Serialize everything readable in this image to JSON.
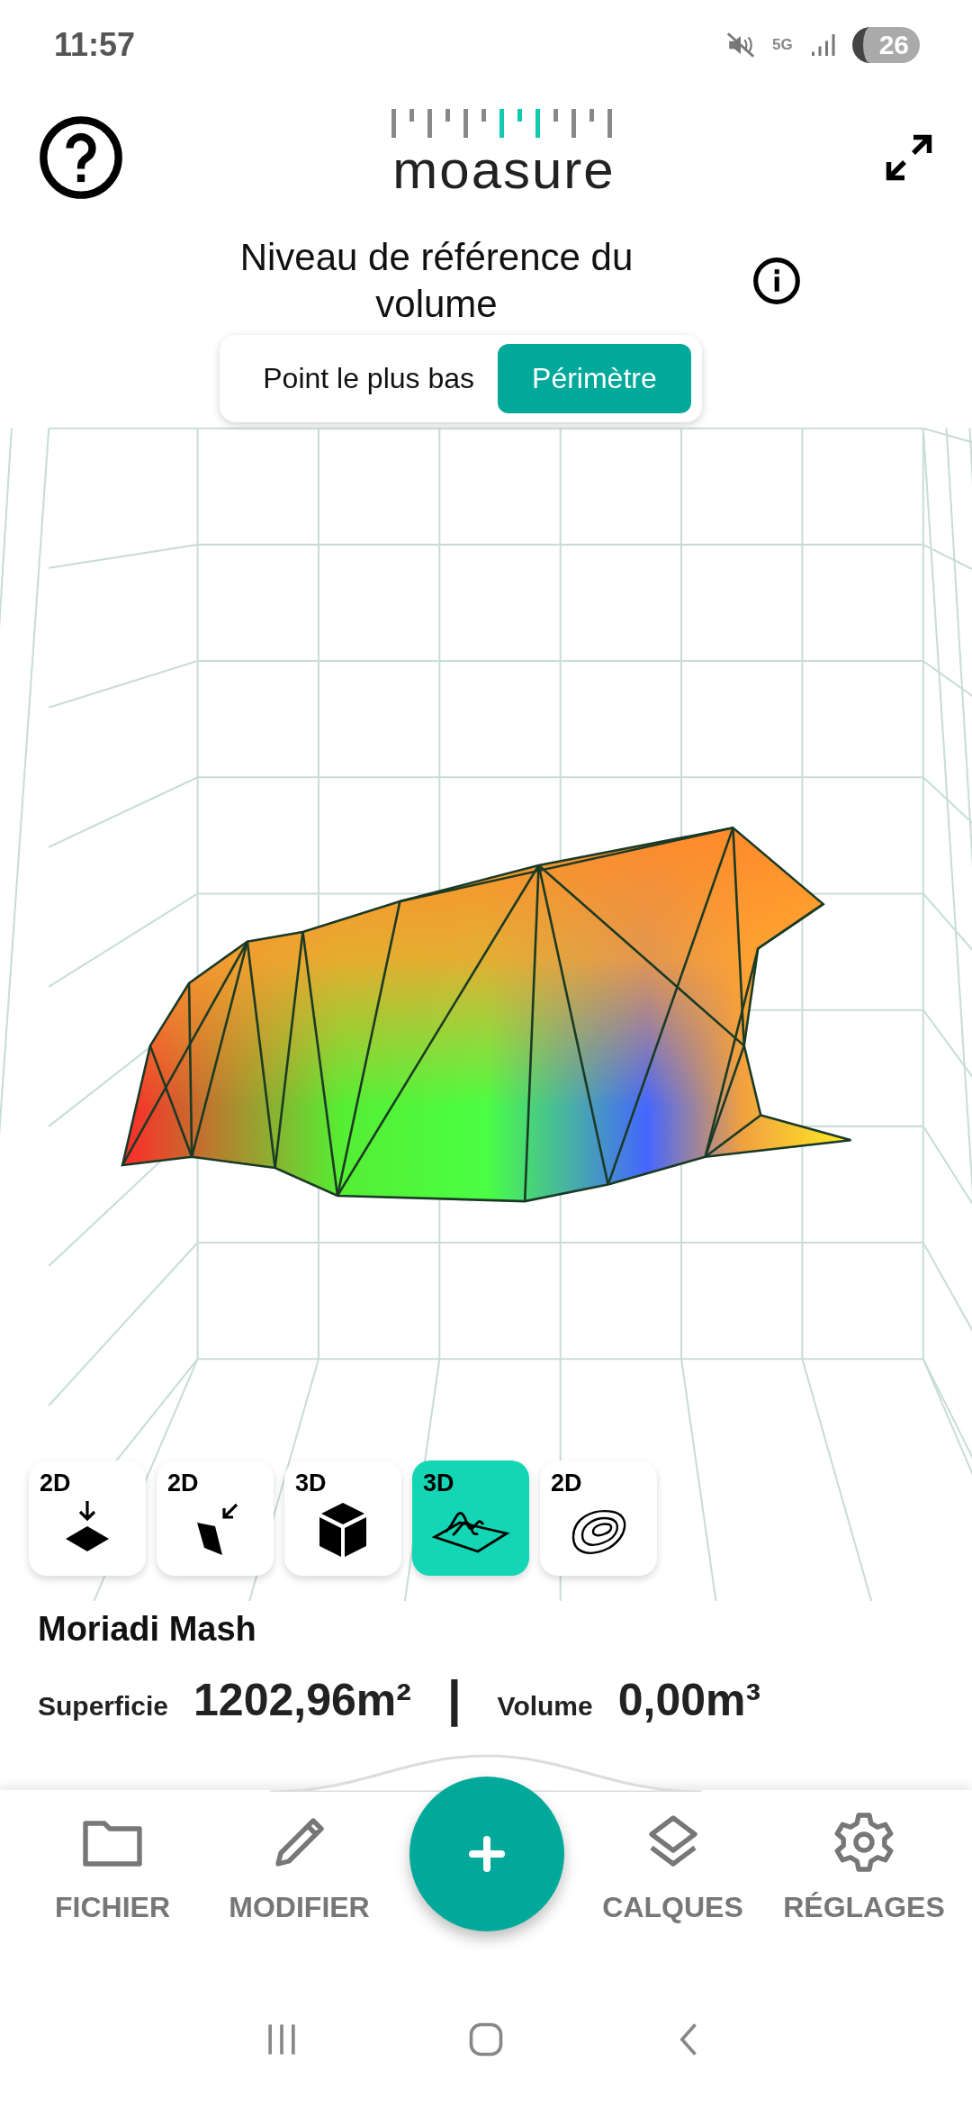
{
  "status_bar": {
    "time": "11:57",
    "network": "5G",
    "battery": "26"
  },
  "header": {
    "logo": "moasure"
  },
  "reference": {
    "title": "Niveau de référence du volume",
    "options": [
      {
        "label": "Point le plus bas",
        "selected": false
      },
      {
        "label": "Périmètre",
        "selected": true
      }
    ]
  },
  "view_modes": [
    {
      "label": "2D",
      "kind": "plan",
      "selected": false
    },
    {
      "label": "2D",
      "kind": "slope",
      "selected": false
    },
    {
      "label": "3D",
      "kind": "cube",
      "selected": false
    },
    {
      "label": "3D",
      "kind": "terrain",
      "selected": true
    },
    {
      "label": "2D",
      "kind": "contour",
      "selected": false
    }
  ],
  "measurement": {
    "name": "Moriadi Mash",
    "stats": [
      {
        "label": "Superficie",
        "value": "1202,96m²"
      },
      {
        "label": "Volume",
        "value": "0,00m³"
      }
    ],
    "separator": "|"
  },
  "nav": [
    {
      "label": "FICHIER",
      "kind": "folder"
    },
    {
      "label": "MODIFIER",
      "kind": "pencil"
    },
    {
      "label": "CALQUES",
      "kind": "layers"
    },
    {
      "label": "RÉGLAGES",
      "kind": "gear"
    }
  ]
}
